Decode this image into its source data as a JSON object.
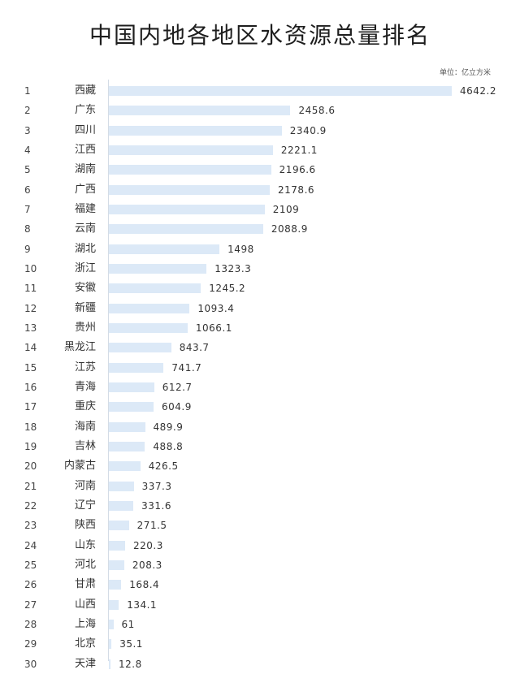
{
  "chart_data": {
    "type": "bar",
    "orientation": "horizontal",
    "title": "中国内地各地区水资源总量排名",
    "unit_label": "单位：亿立方米",
    "xlabel": "",
    "ylabel": "",
    "xlim": [
      0,
      4642.2
    ],
    "grid": false,
    "legend": "none",
    "ranks": [
      1,
      2,
      3,
      4,
      5,
      6,
      7,
      8,
      9,
      10,
      11,
      12,
      13,
      14,
      15,
      16,
      17,
      18,
      19,
      20,
      21,
      22,
      23,
      24,
      25,
      26,
      27,
      28,
      29,
      30
    ],
    "categories": [
      "西藏",
      "广东",
      "四川",
      "江西",
      "湖南",
      "广西",
      "福建",
      "云南",
      "湖北",
      "浙江",
      "安徽",
      "新疆",
      "贵州",
      "黑龙江",
      "江苏",
      "青海",
      "重庆",
      "海南",
      "吉林",
      "内蒙古",
      "河南",
      "辽宁",
      "陕西",
      "山东",
      "河北",
      "甘肃",
      "山西",
      "上海",
      "北京",
      "天津"
    ],
    "values": [
      4642.2,
      2458.6,
      2340.9,
      2221.1,
      2196.6,
      2178.6,
      2109,
      2088.9,
      1498,
      1323.3,
      1245.2,
      1093.4,
      1066.1,
      843.7,
      741.7,
      612.7,
      604.9,
      489.9,
      488.8,
      426.5,
      337.3,
      331.6,
      271.5,
      220.3,
      208.3,
      168.4,
      134.1,
      61,
      35.1,
      12.8
    ],
    "value_labels": [
      "4642.2",
      "2458.6",
      "2340.9",
      "2221.1",
      "2196.6",
      "2178.6",
      "2109",
      "2088.9",
      "1498",
      "1323.3",
      "1245.2",
      "1093.4",
      "1066.1",
      "843.7",
      "741.7",
      "612.7",
      "604.9",
      "489.9",
      "488.8",
      "426.5",
      "337.3",
      "331.6",
      "271.5",
      "220.3",
      "208.3",
      "168.4",
      "134.1",
      "61",
      "35.1",
      "12.8"
    ],
    "bar_color": "#dce9f7"
  }
}
